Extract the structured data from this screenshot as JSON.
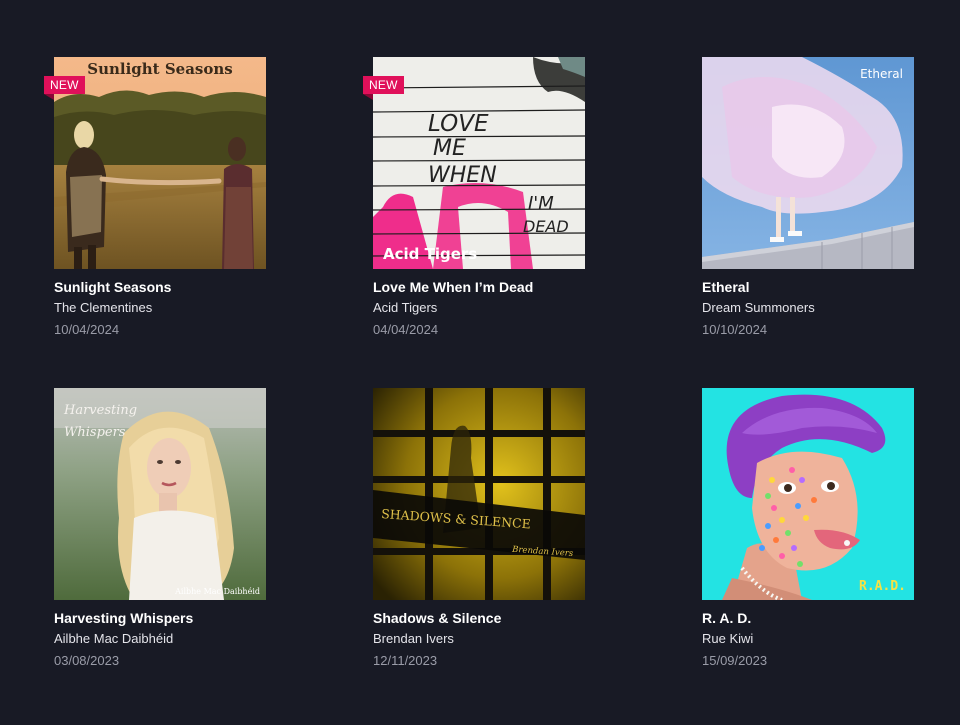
{
  "albums": [
    {
      "title": "Sunlight Seasons",
      "artist": "The Clementines",
      "date": "10/04/2024",
      "badge": "NEW",
      "cover_text": "Sunlight Seasons"
    },
    {
      "title": "Love Me When I’m Dead",
      "artist": "Acid Tigers",
      "date": "04/04/2024",
      "badge": "NEW",
      "cover_text": "Acid Tigers",
      "cover_lines": [
        "LOVE",
        "ME",
        "WHEN",
        "I'M",
        "DEAD"
      ]
    },
    {
      "title": "Etheral",
      "artist": "Dream Summoners",
      "date": "10/10/2024",
      "cover_text": "Etheral"
    },
    {
      "title": "Harvesting Whispers",
      "artist": "Ailbhe Mac Daibhéid",
      "date": "03/08/2023",
      "cover_lines": [
        "Harvesting",
        "Whispers"
      ],
      "cover_credit": "Ailbhe Mac Daibhéid"
    },
    {
      "title": "Shadows & Silence",
      "artist": "Brendan Ivers",
      "date": "12/11/2023",
      "cover_text": "SHADOWS & SILENCE",
      "cover_credit": "Brendan Ivers"
    },
    {
      "title": "R. A. D.",
      "artist": "Rue Kiwi",
      "date": "15/09/2023",
      "cover_text": "R.A.D."
    }
  ]
}
